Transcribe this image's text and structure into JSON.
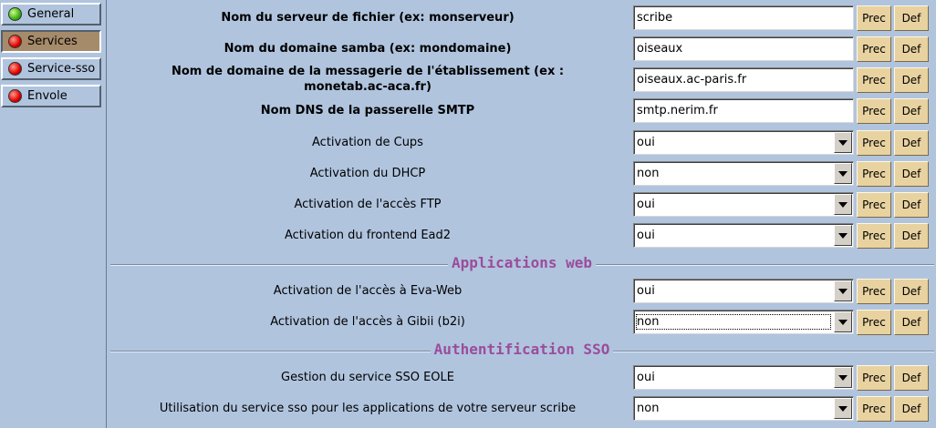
{
  "sidebar": {
    "items": [
      {
        "label": "General",
        "status": "green",
        "active": false
      },
      {
        "label": "Services",
        "status": "red",
        "active": true
      },
      {
        "label": "Service-sso",
        "status": "red",
        "active": false
      },
      {
        "label": "Envole",
        "status": "red",
        "active": false
      }
    ]
  },
  "buttons": {
    "prec": "Prec",
    "def": "Def"
  },
  "rows": [
    {
      "label": "Nom du serveur de fichier (ex: monserveur)",
      "value": "scribe"
    },
    {
      "label": "Nom du domaine samba (ex: mondomaine)",
      "value": "oiseaux"
    },
    {
      "label": "Nom de domaine de la messagerie de l'établissement (ex : monetab.ac-aca.fr)",
      "value": "oiseaux.ac-paris.fr"
    },
    {
      "label": "Nom DNS de la passerelle SMTP",
      "value": "smtp.nerim.fr"
    },
    {
      "label": "Activation de Cups",
      "value": "oui"
    },
    {
      "label": "Activation du DHCP",
      "value": "non"
    },
    {
      "label": "Activation de l'accès FTP",
      "value": "oui"
    },
    {
      "label": "Activation du frontend Ead2",
      "value": "oui"
    },
    {
      "label": "Activation de l'accès à Eva-Web",
      "value": "oui"
    },
    {
      "label": "Activation de l'accès à Gibii (b2i)",
      "value": "non"
    },
    {
      "label": "Gestion du service SSO EOLE",
      "value": "oui"
    },
    {
      "label": "Utilisation du service sso pour les applications de votre serveur scribe",
      "value": "non"
    }
  ],
  "sections": {
    "applications_web": "Applications web",
    "authentification_sso": "Authentification SSO"
  },
  "colors": {
    "background": "#b0c4de",
    "section_title": "#9b4c9b",
    "button": "#e8d2a0",
    "active_tab": "#a68b6a"
  }
}
